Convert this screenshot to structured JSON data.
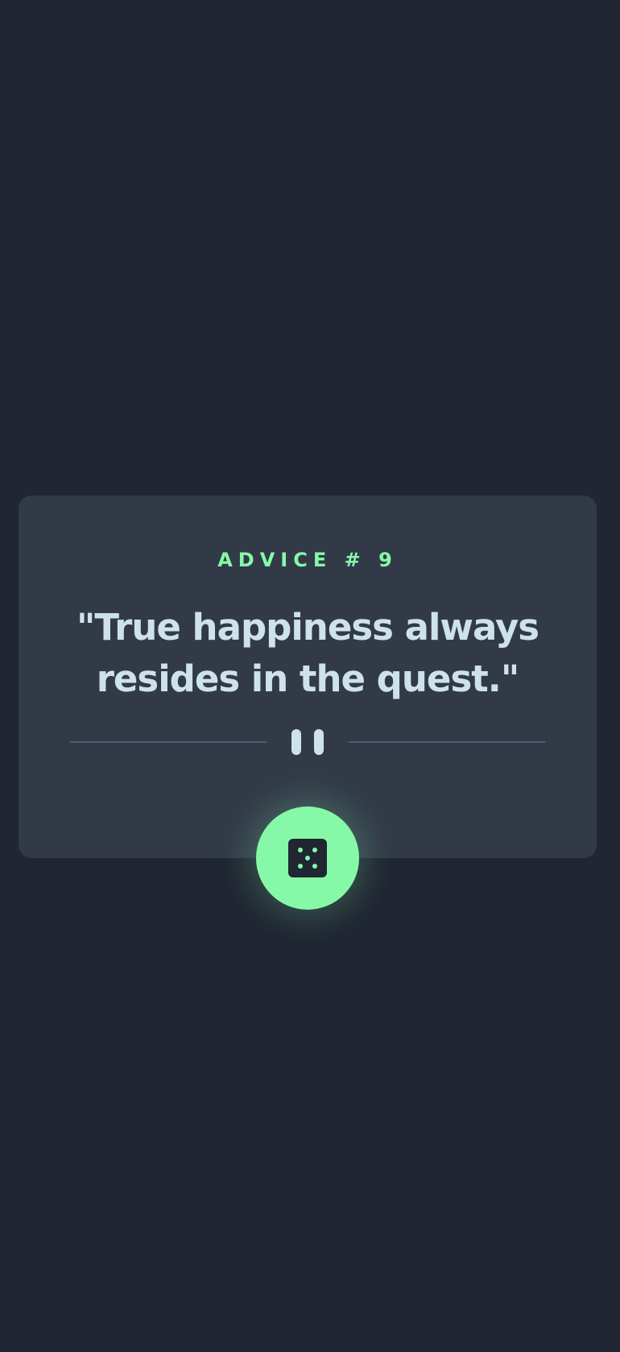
{
  "advice": {
    "label": "ADVICE # 9",
    "quote": "\"True happiness always resides in the quest.\""
  },
  "icons": {
    "divider": "pause-icon",
    "button": "dice-icon"
  },
  "colors": {
    "background": "#202632",
    "card": "#323a48",
    "accent": "#86f9a8",
    "text": "#cee3e9",
    "divider": "#4e5d73"
  }
}
